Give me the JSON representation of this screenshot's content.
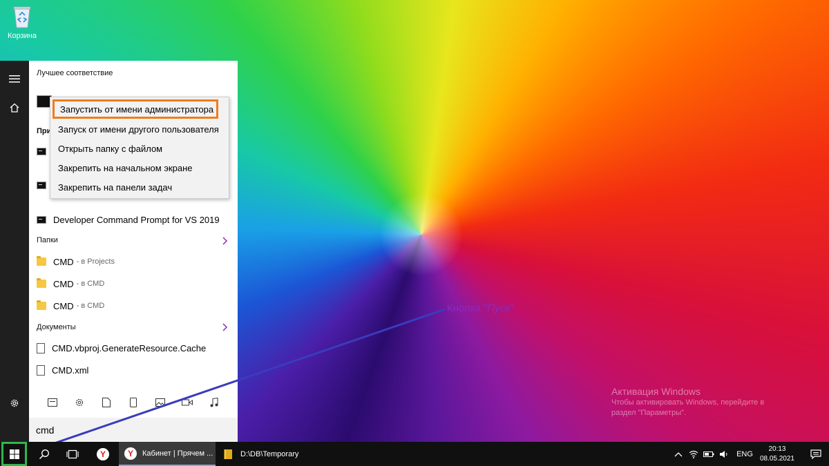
{
  "desktop": {
    "recycle_bin_label": "Корзина",
    "watermark_title": "Активация Windows",
    "watermark_line1": "Чтобы активировать Windows, перейдите в",
    "watermark_line2": "раздел \"Параметры\"."
  },
  "annotation": {
    "prefix": "Кнопка \"",
    "italic": "Пуск",
    "suffix": "\"",
    "color": "#8a2bbd"
  },
  "start_menu": {
    "best_match_heading": "Лучшее соответствие",
    "apps_heading_partial": "При",
    "dev_prompt_label": "Developer Command Prompt for VS 2019",
    "folders_heading": "Папки",
    "folders": [
      {
        "name": "CMD",
        "location": "- в Projects"
      },
      {
        "name": "CMD",
        "location": "- в CMD"
      },
      {
        "name": "CMD",
        "location": "- в CMD"
      }
    ],
    "documents_heading": "Документы",
    "documents": [
      {
        "name": "CMD.vbproj.GenerateResource.Cache"
      },
      {
        "name": "CMD.xml"
      }
    ],
    "search_value": "cmd"
  },
  "context_menu": {
    "items": [
      "Запустить от имени администратора",
      "Запуск от имени другого пользователя",
      "Открыть папку с файлом",
      "Закрепить на начальном экране",
      "Закрепить на панели задач"
    ],
    "highlight_color": "#f07c1c"
  },
  "taskbar": {
    "apps": [
      {
        "label": "Кабинет | Прячем ..."
      },
      {
        "label": "D:\\DB\\Temporary"
      }
    ],
    "language": "ENG",
    "time": "20:13",
    "date": "08.05.2021",
    "start_highlight_color": "#2fb84a"
  }
}
